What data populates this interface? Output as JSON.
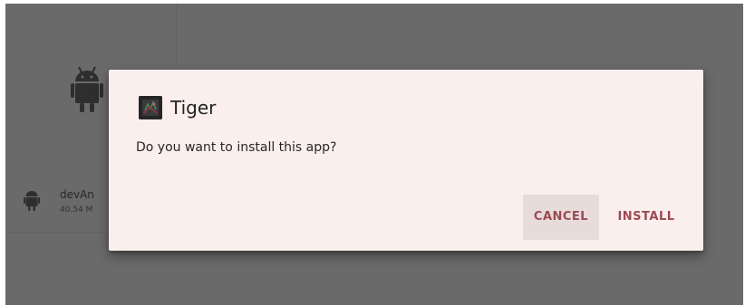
{
  "background": {
    "file": {
      "name": "devAn",
      "size": "40.54 M"
    },
    "icons": [
      "android-icon"
    ]
  },
  "dialog": {
    "app_icon": "app-icon",
    "title": "Tiger",
    "message": "Do you want to install this app?",
    "buttons": {
      "cancel": "CANCEL",
      "install": "INSTALL"
    }
  },
  "colors": {
    "scrim": "#6a6a6a",
    "dialog_background": "#fbefed",
    "button_text": "#9c4a55",
    "cancel_pressed": "#e7dcda"
  }
}
